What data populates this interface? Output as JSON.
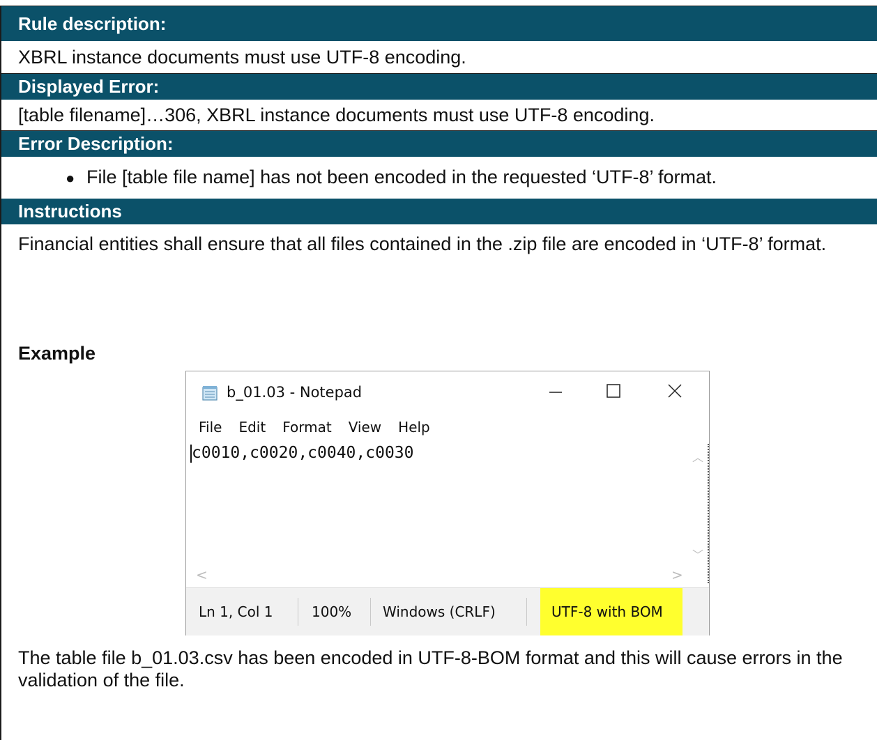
{
  "sections": {
    "rule_description": {
      "header": "Rule description:",
      "text": "XBRL instance documents must use UTF-8 encoding."
    },
    "displayed_error": {
      "header": "Displayed Error:",
      "text": "[table filename]…306, XBRL instance documents must use UTF-8 encoding."
    },
    "error_description": {
      "header": "Error Description:",
      "bullet": "File [table file name] has not been encoded in the requested ‘UTF-8’ format."
    },
    "instructions": {
      "header": "Instructions",
      "text": "Financial entities shall ensure that all files contained in the .zip file are encoded in ‘UTF-8’ format.",
      "example_label": "Example",
      "footer": "The table file b_01.03.csv has been encoded in UTF-8-BOM format and this will cause errors in the validation of the file."
    }
  },
  "notepad": {
    "title": "b_01.03 - Notepad",
    "menu": [
      "File",
      "Edit",
      "Format",
      "View",
      "Help"
    ],
    "content": "c0010,c0020,c0040,c0030",
    "status": {
      "position": "Ln 1, Col 1",
      "zoom": "100%",
      "line_ending": "Windows (CRLF)",
      "encoding": "UTF-8 with BOM"
    },
    "highlight_color": "#ffff2e",
    "icons": [
      "notepad-icon",
      "minimize-icon",
      "maximize-icon",
      "close-icon"
    ]
  },
  "colors": {
    "header_bg": "#0b5169",
    "header_text": "#ffffff"
  }
}
